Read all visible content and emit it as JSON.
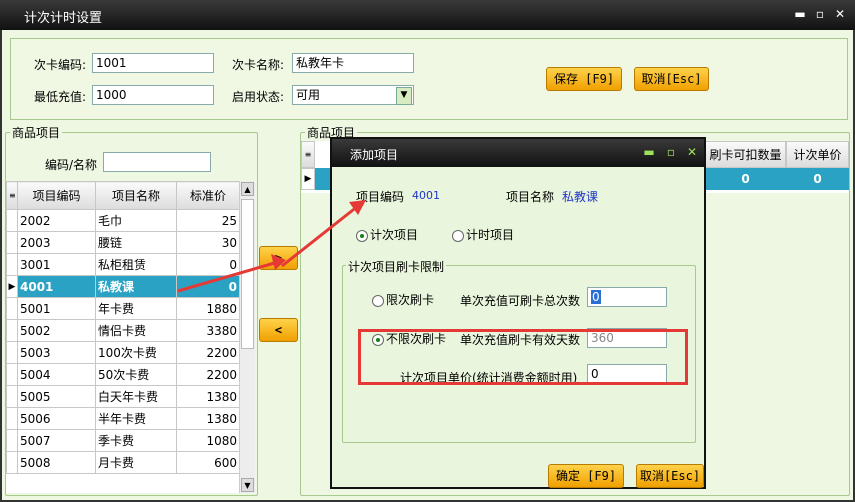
{
  "window": {
    "title": "计次计时设置"
  },
  "form": {
    "card_code_label": "次卡编码:",
    "card_code_value": "1001",
    "card_name_label": "次卡名称:",
    "card_name_value": "私教年卡",
    "min_recharge_label": "最低充值:",
    "min_recharge_value": "1000",
    "status_label": "启用状态:",
    "status_value": "可用",
    "save_button": "保存 [F9]",
    "cancel_button": "取消[Esc]"
  },
  "left": {
    "group_title": "商品项目",
    "search_label": "编码/名称",
    "search_value": "",
    "columns": [
      "项目编码",
      "项目名称",
      "标准价"
    ],
    "rows": [
      {
        "code": "2002",
        "name": "毛巾",
        "price": "25"
      },
      {
        "code": "2003",
        "name": "腰链",
        "price": "30"
      },
      {
        "code": "3001",
        "name": "私柜租赁",
        "price": "0"
      },
      {
        "code": "4001",
        "name": "私教课",
        "price": "0"
      },
      {
        "code": "5001",
        "name": "年卡费",
        "price": "1880"
      },
      {
        "code": "5002",
        "name": "情侣卡费",
        "price": "3380"
      },
      {
        "code": "5003",
        "name": "100次卡费",
        "price": "2200"
      },
      {
        "code": "5004",
        "name": "50次卡费",
        "price": "2200"
      },
      {
        "code": "5005",
        "name": "白天年卡费",
        "price": "1380"
      },
      {
        "code": "5006",
        "name": "半年卡费",
        "price": "1380"
      },
      {
        "code": "5007",
        "name": "季卡费",
        "price": "1080"
      },
      {
        "code": "5008",
        "name": "月卡费",
        "price": "600"
      }
    ],
    "selected_index": 3
  },
  "transfer": {
    "add": ">",
    "remove": "<"
  },
  "right": {
    "group_title": "商品项目",
    "columns": [
      "刷卡可扣数量",
      "计次单价"
    ],
    "row": {
      "qty": "0",
      "unit": "0"
    }
  },
  "dialog": {
    "title": "添加项目",
    "code_label": "项目编码",
    "code_value": "4001",
    "name_label": "项目名称",
    "name_value": "私教课",
    "type_count": "计次项目",
    "type_time": "计时项目",
    "limit_group": "计次项目刷卡限制",
    "limited_label": "限次刷卡",
    "limited_desc": "单次充值可刷卡总次数",
    "limited_value": "0",
    "unlimited_label": "不限次刷卡",
    "unlimited_desc": "单次充值刷卡有效天数",
    "unlimited_value": "360",
    "unit_price_label": "计次项目单价(统计消费金额时用)",
    "unit_price_value": "0",
    "ok_button": "确定 [F9]",
    "cancel_button": "取消[Esc]"
  },
  "colors": {
    "accent": "#f0a000",
    "selection": "#2aa2c4",
    "highlight": "#e53935"
  }
}
